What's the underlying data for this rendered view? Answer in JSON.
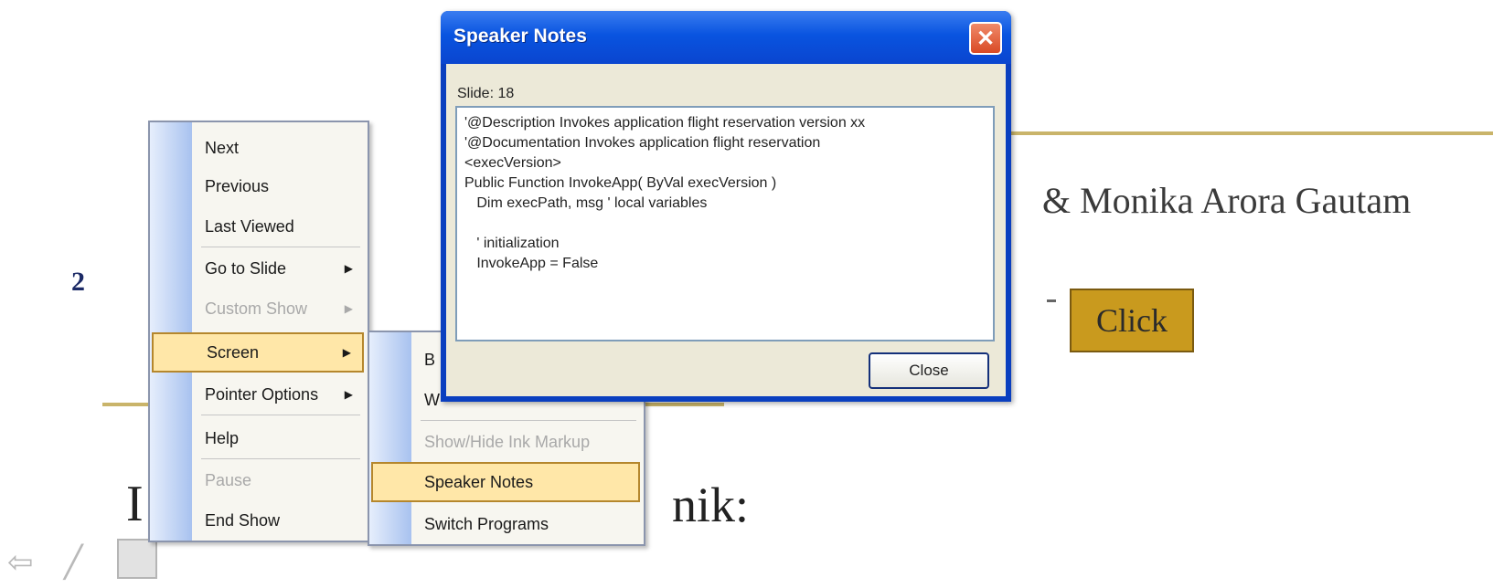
{
  "slide": {
    "author_text": "& Monika Arora Gautam",
    "slide_number": "2",
    "click_button": "Click",
    "body_text_left": "I",
    "body_text_right": "nik:"
  },
  "context_menu": {
    "items": [
      {
        "label": "Next",
        "enabled": true,
        "submenu": false
      },
      {
        "label": "Previous",
        "enabled": true,
        "submenu": false
      },
      {
        "label": "Last Viewed",
        "enabled": true,
        "submenu": false
      },
      {
        "label": "Go to Slide",
        "enabled": true,
        "submenu": true
      },
      {
        "label": "Custom Show",
        "enabled": false,
        "submenu": true
      },
      {
        "label": "Screen",
        "enabled": true,
        "submenu": true,
        "highlighted": true
      },
      {
        "label": "Pointer Options",
        "enabled": true,
        "submenu": true
      },
      {
        "label": "Help",
        "enabled": true,
        "submenu": false
      },
      {
        "label": "Pause",
        "enabled": false,
        "submenu": false
      },
      {
        "label": "End Show",
        "enabled": true,
        "submenu": false
      }
    ],
    "arrow_glyph": "▶"
  },
  "screen_submenu": {
    "items": [
      {
        "label": "B",
        "enabled": true
      },
      {
        "label": "W",
        "enabled": true
      },
      {
        "label": "Show/Hide Ink Markup",
        "enabled": false
      },
      {
        "label": "Speaker Notes",
        "enabled": true,
        "highlighted": true
      },
      {
        "label": "Switch Programs",
        "enabled": true
      }
    ]
  },
  "dialog": {
    "title": "Speaker Notes",
    "close_glyph": "✕",
    "slide_label": "Slide: 18",
    "notes": "'@Description Invokes application flight reservation version xx\n'@Documentation Invokes application flight reservation\n<execVersion>\nPublic Function InvokeApp( ByVal execVersion )\n   Dim execPath, msg ' local variables\n\n   ' initialization\n   InvokeApp = False",
    "close_button": "Close"
  },
  "toolbar": {
    "icons": [
      "arrow-icon",
      "pen-icon",
      "slide-menu-icon"
    ]
  },
  "colors": {
    "titlebar": "#0954e0",
    "menu_highlight": "#ffe7a8",
    "slide_accent": "#c9b46a",
    "click_button_bg": "#c99a1e"
  }
}
